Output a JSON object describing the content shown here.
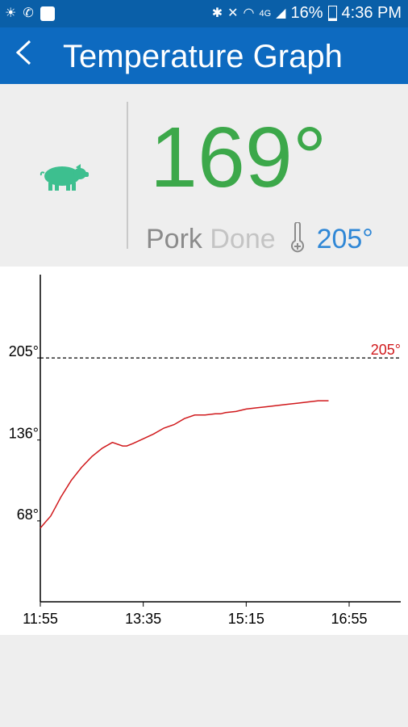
{
  "status_bar": {
    "battery": "16%",
    "time": "4:36 PM",
    "network": "4G",
    "icons": [
      "weather-icon",
      "wifi-call-icon",
      "app-notification-icon",
      "bluetooth-icon",
      "mute-icon",
      "wifi-icon",
      "signal-icon",
      "battery-icon"
    ]
  },
  "header": {
    "title": "Temperature Graph",
    "back_icon": "back-chevron-icon"
  },
  "reading": {
    "current_temp": "169°",
    "meat": "Pork",
    "doneness": "Done",
    "target_temp": "205°",
    "meat_icon": "pig-icon",
    "target_icon": "thermometer-icon"
  },
  "colors": {
    "status_bar": "#0a5fa8",
    "app_bar": "#0d6ac0",
    "current_temp": "#3ca84a",
    "target": "#2f87d6",
    "line": "#d0191c",
    "pig": "#3dbf8f"
  },
  "chart_data": {
    "type": "line",
    "x_tick_labels": [
      "11:55",
      "13:35",
      "15:15",
      "16:55"
    ],
    "x_tick_minutes": [
      0,
      100,
      200,
      300
    ],
    "y_tick_labels": [
      "205°",
      "136°",
      "68°"
    ],
    "y_tick_values": [
      205,
      136,
      68
    ],
    "ylim": [
      0,
      275
    ],
    "xlim": [
      0,
      352
    ],
    "target_line": {
      "value": 205,
      "label": "205°",
      "style": "dashed"
    },
    "series": [
      {
        "x": [
          0,
          5,
          10,
          15,
          20,
          30,
          40,
          50,
          60,
          70,
          80,
          84,
          90,
          100,
          110,
          120,
          130,
          140,
          150,
          160,
          170,
          175,
          180,
          190,
          200,
          210,
          220,
          230,
          240,
          250,
          260,
          270,
          280
        ],
        "values": [
          62,
          67,
          72,
          80,
          88,
          102,
          113,
          122,
          129,
          134,
          131,
          131,
          133,
          137,
          141,
          146,
          149,
          154,
          157,
          157,
          158,
          158,
          159,
          160,
          162,
          163,
          164,
          165,
          166,
          167,
          168,
          169,
          169
        ]
      }
    ],
    "grid": false,
    "legend": "none"
  }
}
